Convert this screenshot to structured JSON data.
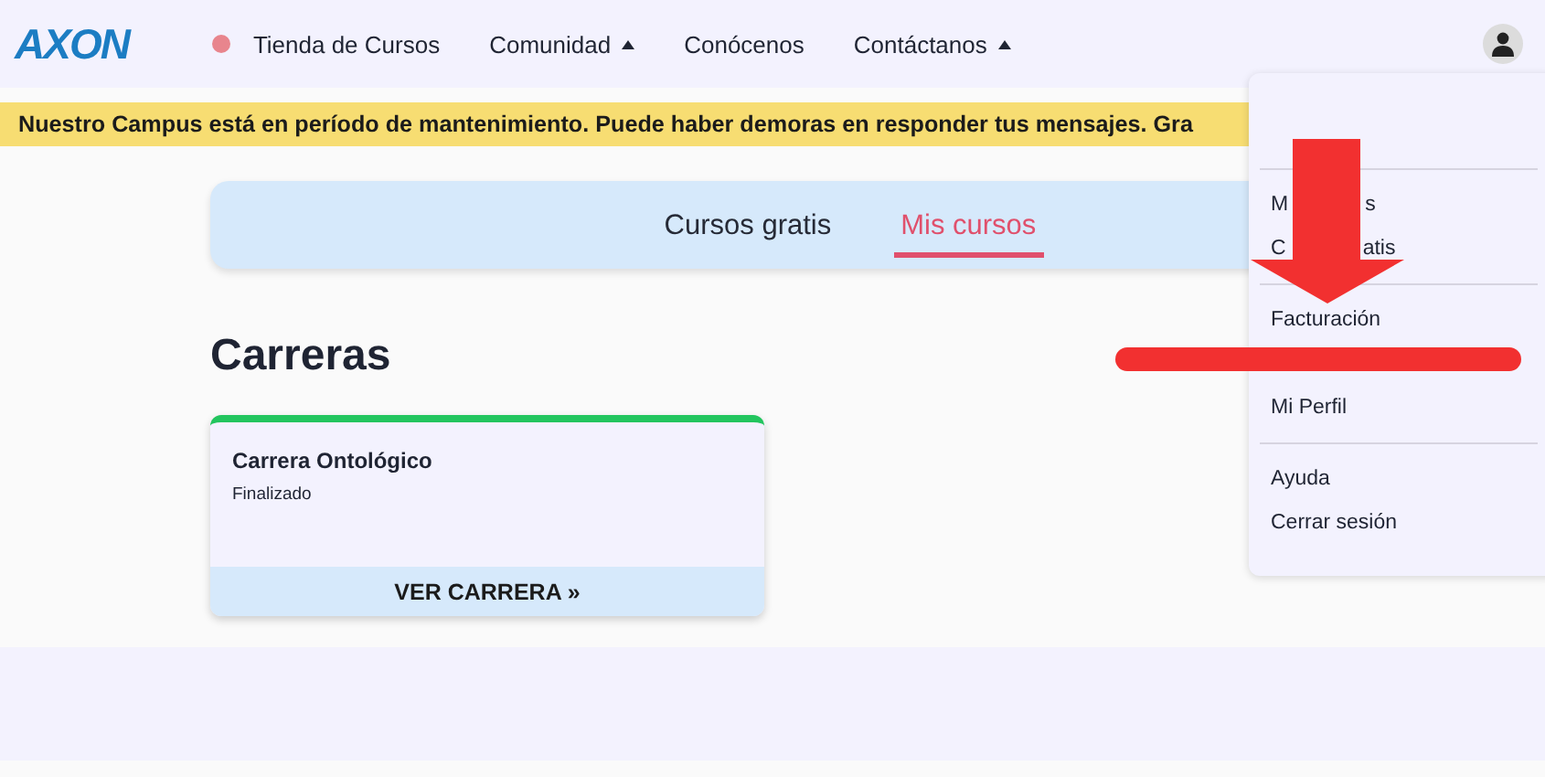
{
  "logo": "AXON",
  "nav": [
    {
      "label": "Tienda de Cursos",
      "color": "#e8858d",
      "has_caret": false
    },
    {
      "label": "Comunidad",
      "has_caret": true
    },
    {
      "label": "Conócenos",
      "has_caret": false
    },
    {
      "label": "Contáctanos",
      "has_caret": true
    }
  ],
  "banner": "Nuestro Campus está en período de mantenimiento. Puede haber demoras en responder tus mensajes. Gra",
  "tabs": [
    {
      "label": "Cursos gratis",
      "selected": false
    },
    {
      "label": "Mis cursos",
      "selected": true
    }
  ],
  "section_title": "Carreras",
  "cards": [
    {
      "title": "Carrera Ontológico",
      "status": "Finalizado",
      "color": "#22c55e",
      "action": "VER CARRERA »"
    }
  ],
  "user_menu": [
    {
      "kind": "divider"
    },
    {
      "kind": "split",
      "start": "M",
      "end": "s"
    },
    {
      "kind": "split",
      "start": "C",
      "end": "atis"
    },
    {
      "kind": "divider"
    },
    {
      "kind": "item",
      "label": "Facturación"
    },
    {
      "kind": "struck"
    },
    {
      "kind": "item",
      "label": "Mi Perfil"
    },
    {
      "kind": "divider"
    },
    {
      "kind": "item",
      "label": "Ayuda"
    },
    {
      "kind": "item",
      "label": "Cerrar sesión"
    }
  ]
}
